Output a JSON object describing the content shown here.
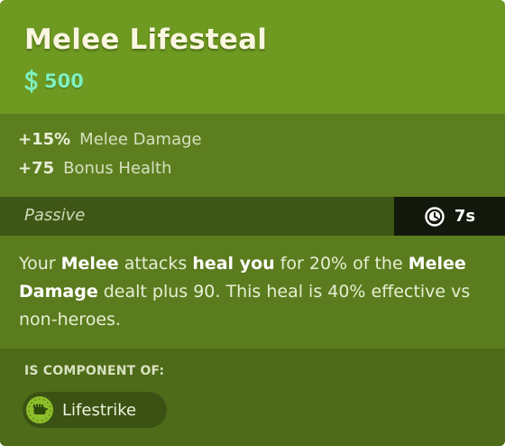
{
  "item": {
    "title": "Melee Lifesteal",
    "cost": "500",
    "cost_icon": "souls-icon",
    "accent_cost_color": "#7ff0bf"
  },
  "stats": [
    {
      "value": "+15%",
      "label": "Melee Damage"
    },
    {
      "value": "+75",
      "label": "Bonus Health"
    }
  ],
  "passive": {
    "label": "Passive",
    "cooldown": "7s",
    "cooldown_icon": "stopwatch-icon"
  },
  "description": {
    "p1": "Your ",
    "b1": "Melee",
    "p2": " attacks ",
    "b2": "heal you",
    "p3": " for 20% of the ",
    "b3": "Melee Damage",
    "p4": " dealt plus 90. This heal is 40% effective vs non-heroes."
  },
  "component": {
    "heading": "IS COMPONENT OF:",
    "items": [
      {
        "name": "Lifestrike",
        "icon": "fist-icon"
      }
    ]
  },
  "colors": {
    "header_bg": "#6e9a21",
    "body_bg": "#5c7d1f",
    "passive_bg": "#3f5716",
    "cooldown_bg": "#13180c",
    "component_bg": "#4d6b18"
  }
}
